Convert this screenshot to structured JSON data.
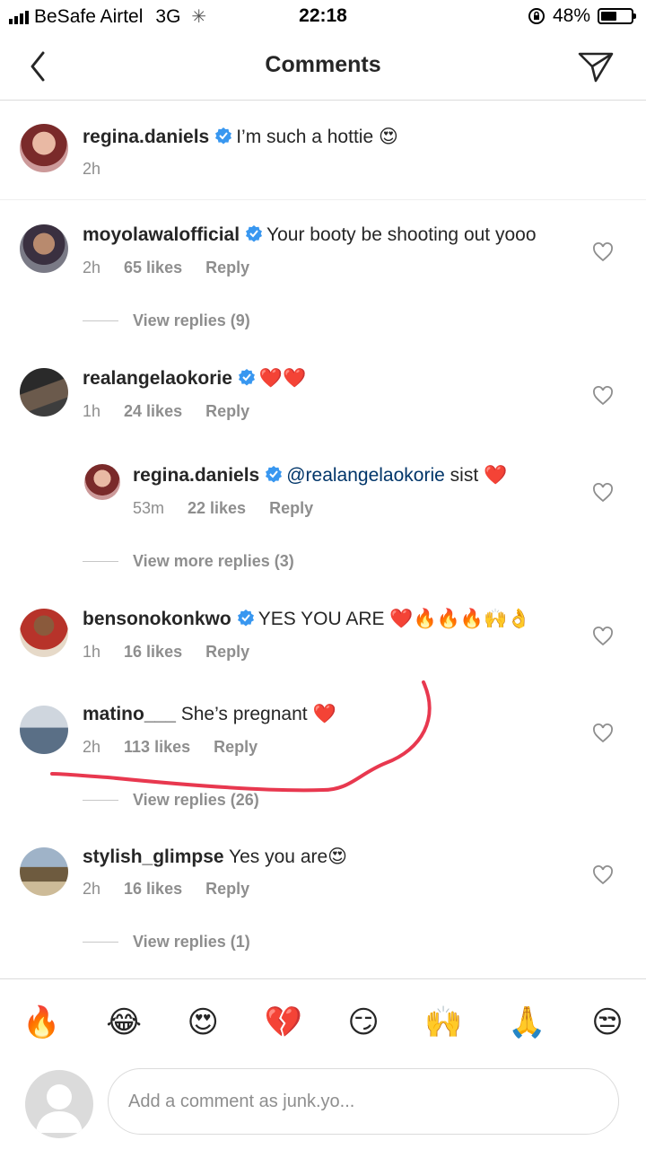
{
  "status_bar": {
    "carrier": "BeSafe Airtel",
    "network": "3G",
    "time": "22:18",
    "battery": "48%",
    "battery_level": 0.48
  },
  "header": {
    "title": "Comments"
  },
  "caption": {
    "username": "regina.daniels",
    "text": "I’m such a hottie 😍",
    "time": "2h"
  },
  "comments": [
    {
      "username": "moyolawalofficial",
      "text": "Your booty be shooting out yooo",
      "time": "2h",
      "likes": "65 likes",
      "reply": "Reply",
      "view_replies": "View replies (9)"
    },
    {
      "username": "realangelaokorie",
      "text": "❤️❤️",
      "time": "1h",
      "likes": "24 likes",
      "reply": "Reply",
      "view_replies": "View more replies (3)",
      "reply_item": {
        "username": "regina.daniels",
        "mention": "@realangelaokorie",
        "text": " sist ❤️",
        "time": "53m",
        "likes": "22 likes",
        "reply": "Reply"
      }
    },
    {
      "username": "bensonokonkwo",
      "text": "YES YOU ARE ❤️🔥🔥🔥🙌👌",
      "time": "1h",
      "likes": "16 likes",
      "reply": "Reply"
    },
    {
      "username": "matino___",
      "text": "She’s pregnant ❤️",
      "time": "2h",
      "likes": "113 likes",
      "reply": "Reply",
      "view_replies": "View replies (26)"
    },
    {
      "username": "stylish_glimpse",
      "text": "Yes you are😍",
      "time": "2h",
      "likes": "16 likes",
      "reply": "Reply",
      "view_replies": "View replies (1)"
    }
  ],
  "emoji_bar": [
    "🔥",
    "😂",
    "😍",
    "💔",
    "😏",
    "🙌",
    "🙏",
    "😒"
  ],
  "comment_input": {
    "placeholder": "Add a comment as junk.yo..."
  },
  "colors": {
    "annotation": "#e8384f",
    "verified": "#3897f0",
    "muted": "#8e8e8e"
  }
}
